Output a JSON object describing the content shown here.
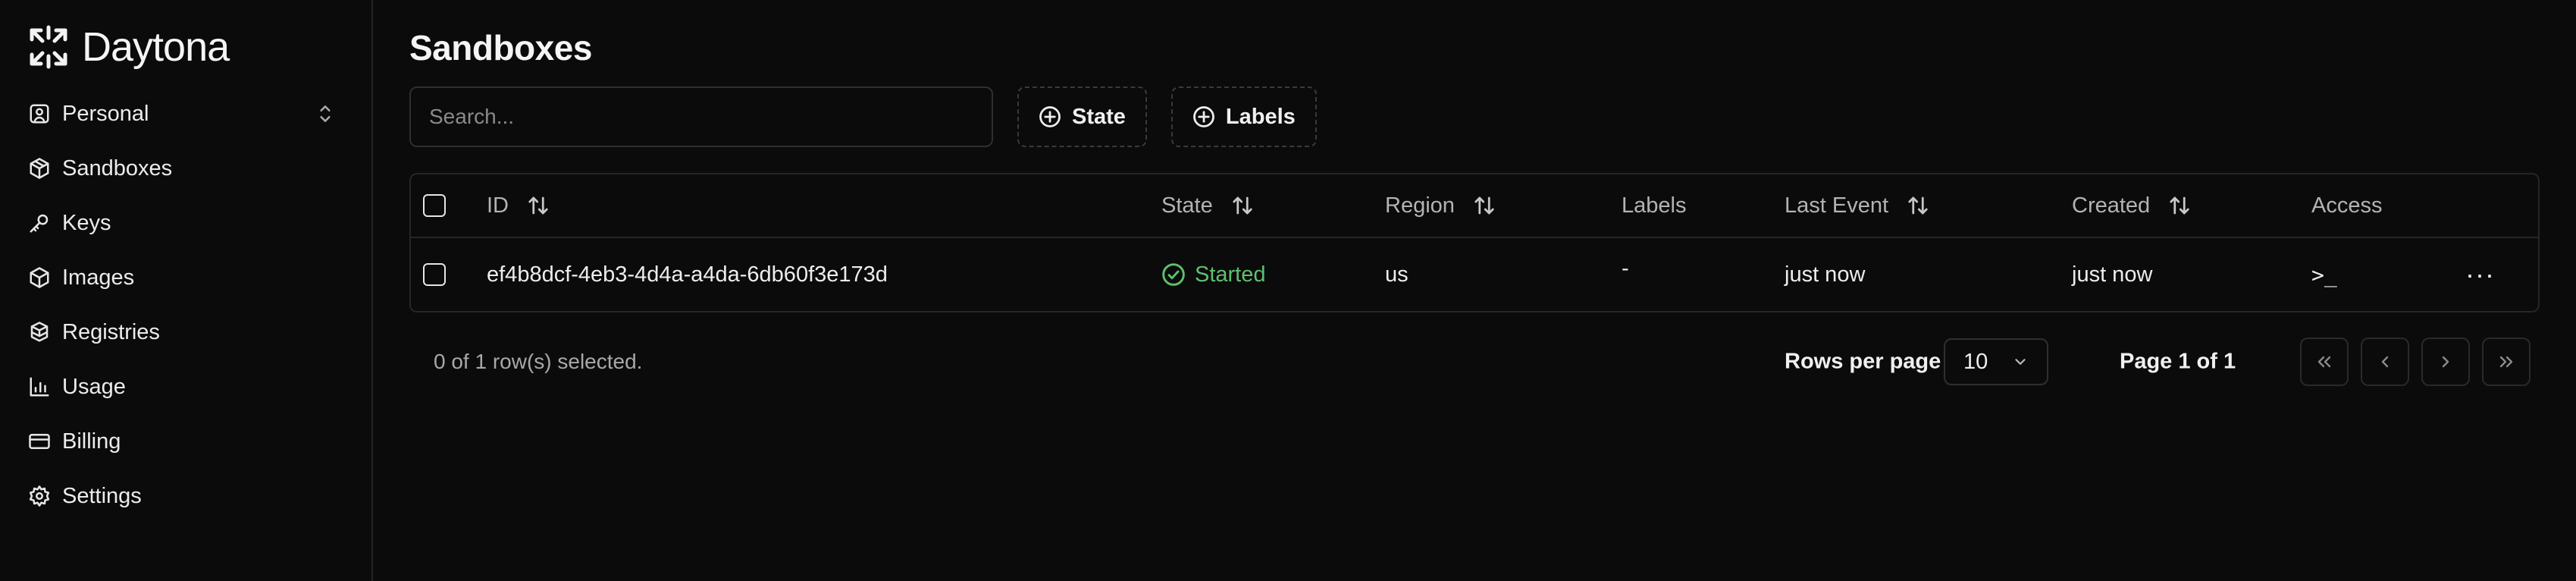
{
  "brand": {
    "name": "Daytona"
  },
  "sidebar": {
    "workspace_label": "Personal",
    "items": [
      {
        "label": "Sandboxes",
        "icon": "box-icon"
      },
      {
        "label": "Keys",
        "icon": "key-icon"
      },
      {
        "label": "Images",
        "icon": "package-icon"
      },
      {
        "label": "Registries",
        "icon": "boxes-icon"
      },
      {
        "label": "Usage",
        "icon": "chart-icon"
      },
      {
        "label": "Billing",
        "icon": "credit-card-icon"
      },
      {
        "label": "Settings",
        "icon": "gear-icon"
      }
    ]
  },
  "page": {
    "title": "Sandboxes"
  },
  "toolbar": {
    "search_placeholder": "Search...",
    "state_filter_label": "State",
    "labels_filter_label": "Labels"
  },
  "table": {
    "columns": {
      "id": "ID",
      "state": "State",
      "region": "Region",
      "labels": "Labels",
      "last_event": "Last Event",
      "created": "Created",
      "access": "Access"
    },
    "rows": [
      {
        "id": "ef4b8dcf-4eb3-4d4a-a4da-6db60f3e173d",
        "state": "Started",
        "region": "us",
        "labels": "-",
        "last_event": "just now",
        "created": "just now",
        "access": ">_",
        "actions": "···"
      }
    ]
  },
  "footer": {
    "selected_text": "0 of 1 row(s) selected.",
    "rows_per_page_label": "Rows per page",
    "rows_per_page_value": "10",
    "page_info": "Page 1 of 1"
  },
  "colors": {
    "background": "#0b0b0b",
    "status_started": "#5fbf6f",
    "border": "#262626"
  }
}
